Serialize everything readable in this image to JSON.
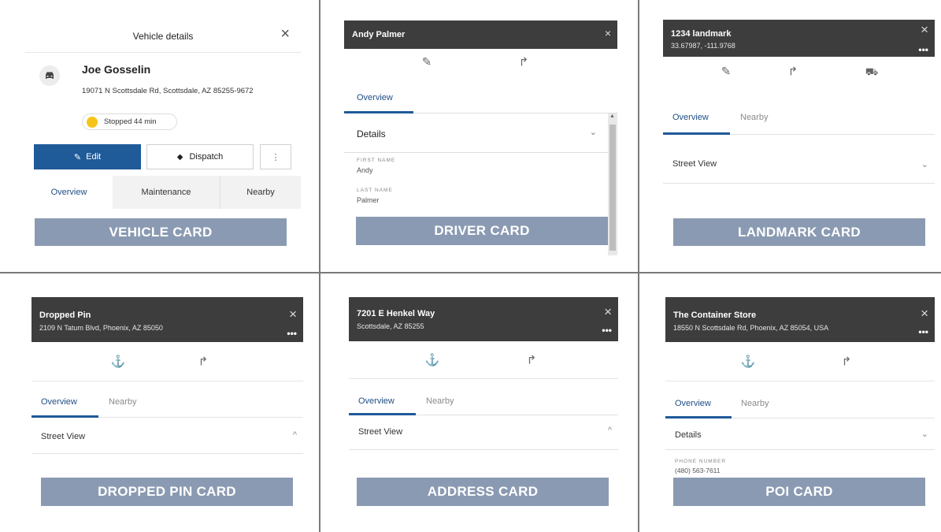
{
  "vehicle": {
    "header_title": "Vehicle details",
    "name": "Joe Gosselin",
    "address": "19071 N Scottsdale Rd, Scottsdale, AZ 85255-9672",
    "status": "Stopped 44 min",
    "status_color": "#f5c518",
    "edit_label": "Edit",
    "dispatch_label": "Dispatch",
    "tabs": [
      "Overview",
      "Maintenance",
      "Nearby"
    ],
    "banner": "VEHICLE CARD"
  },
  "driver": {
    "title": "Andy Palmer",
    "tab": "Overview",
    "section": "Details",
    "fields": [
      {
        "label": "FIRST NAME",
        "value": "Andy"
      },
      {
        "label": "LAST NAME",
        "value": "Palmer"
      }
    ],
    "banner": "DRIVER CARD"
  },
  "landmark": {
    "title": "1234 landmark",
    "subtitle": "33.67987, -111.9768",
    "tabs": [
      "Overview",
      "Nearby"
    ],
    "section": "Street View",
    "banner": "LANDMARK CARD"
  },
  "dropped_pin": {
    "title": "Dropped Pin",
    "subtitle": "2109 N Tatum Blvd, Phoenix, AZ 85050",
    "tabs": [
      "Overview",
      "Nearby"
    ],
    "section": "Street View",
    "banner": "DROPPED PIN CARD"
  },
  "address": {
    "title": "7201 E Henkel Way",
    "subtitle": "Scottsdale, AZ 85255",
    "tabs": [
      "Overview",
      "Nearby"
    ],
    "section": "Street View",
    "banner": "ADDRESS CARD"
  },
  "poi": {
    "title": "The Container Store",
    "subtitle": "18550 N Scottsdale Rd, Phoenix, AZ 85054, USA",
    "tabs": [
      "Overview",
      "Nearby"
    ],
    "section": "Details",
    "field_label": "PHONE NUMBER",
    "field_value": "(480) 563-7611",
    "banner": "POI CARD"
  },
  "colors": {
    "header_dark": "#3d3d3d",
    "accent_blue": "#1f5a99",
    "banner": "#8a9ab2",
    "divider": "#7a7a7a"
  }
}
